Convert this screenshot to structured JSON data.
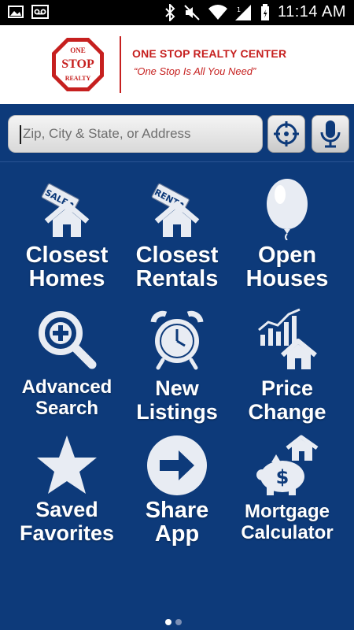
{
  "status_bar": {
    "time": "11:14 AM",
    "left_icons": [
      "image-icon",
      "voicemail-icon"
    ],
    "right_icons": [
      "bluetooth-icon",
      "mute-icon",
      "wifi-icon",
      "signal-icon",
      "battery-icon"
    ]
  },
  "header": {
    "logo_line1": "ONE",
    "logo_line2": "STOP",
    "logo_line3": "REALTY",
    "company_name": "ONE STOP REALTY CENTER",
    "tagline": "“One Stop Is All You Need”"
  },
  "search": {
    "placeholder": "Zip, City & State, or Address",
    "value": "",
    "locate_icon": "crosshair-icon",
    "voice_icon": "microphone-icon"
  },
  "tiles": [
    {
      "line1": "Closest",
      "line2": "Homes",
      "icon": "sale-house-icon"
    },
    {
      "line1": "Closest",
      "line2": "Rentals",
      "icon": "rent-house-icon"
    },
    {
      "line1": "Open",
      "line2": "Houses",
      "icon": "balloon-icon"
    },
    {
      "line1": "Advanced",
      "line2": "Search",
      "icon": "magnifier-plus-icon"
    },
    {
      "line1": "New",
      "line2": "Listings",
      "icon": "alarm-clock-icon"
    },
    {
      "line1": "Price",
      "line2": "Change",
      "icon": "price-chart-house-icon"
    },
    {
      "line1": "Saved",
      "line2": "Favorites",
      "icon": "star-icon"
    },
    {
      "line1": "Share",
      "line2": "App",
      "icon": "arrow-circle-icon"
    },
    {
      "line1": "Mortgage",
      "line2": "Calculator",
      "icon": "piggy-bank-house-icon"
    }
  ],
  "pager": {
    "current": 1,
    "total": 2
  },
  "colors": {
    "background": "#0d3a7a",
    "brand_red": "#c6201f",
    "text": "#ffffff"
  }
}
